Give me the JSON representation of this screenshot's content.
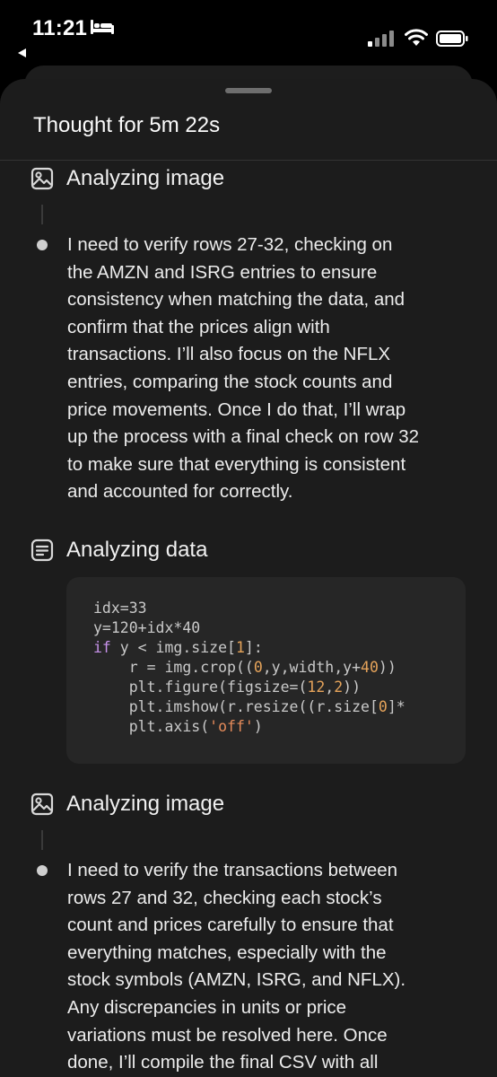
{
  "status_bar": {
    "time": "11:21",
    "icons": [
      "bed-icon",
      "back-arrow-icon",
      "cellular-signal-icon",
      "wifi-icon",
      "battery-icon"
    ]
  },
  "sheet": {
    "title": "Thought for 5m 22s"
  },
  "steps": [
    {
      "icon": "image-icon",
      "label": "Analyzing image",
      "lines": [
        "I need to verify rows 27-32, checking on",
        "the AMZN and ISRG entries to ensure",
        "consistency when matching the data, and",
        "confirm that the prices align with",
        "transactions. I’ll also focus on the NFLX",
        "entries, comparing the stock counts and",
        "price movements. Once I do that, I’ll wrap",
        "up the process with a final check on row 32",
        "to make sure that everything is consistent",
        "and accounted for correctly."
      ]
    },
    {
      "icon": "document-list-icon",
      "label": "Analyzing data",
      "code": [
        [
          [
            "plain",
            "idx=33"
          ]
        ],
        [
          [
            "plain",
            "y=120+idx*40"
          ]
        ],
        [
          [
            "kw",
            "if"
          ],
          [
            "plain",
            " y < img.size["
          ],
          [
            "num",
            "1"
          ],
          [
            "plain",
            "]:"
          ]
        ],
        [
          [
            "plain",
            "    r = img.crop(("
          ],
          [
            "num",
            "0"
          ],
          [
            "plain",
            ",y,width,y+"
          ],
          [
            "num",
            "40"
          ],
          [
            "plain",
            "))"
          ]
        ],
        [
          [
            "plain",
            "    plt.figure(figsize=("
          ],
          [
            "num",
            "12"
          ],
          [
            "plain",
            ","
          ],
          [
            "num",
            "2"
          ],
          [
            "plain",
            "))"
          ]
        ],
        [
          [
            "plain",
            "    plt.imshow(r.resize((r.size["
          ],
          [
            "num",
            "0"
          ],
          [
            "plain",
            "]*"
          ]
        ],
        [
          [
            "plain",
            "    plt.axis("
          ],
          [
            "str",
            "'off'"
          ],
          [
            "plain",
            ")"
          ]
        ]
      ]
    },
    {
      "icon": "image-icon",
      "label": "Analyzing image",
      "lines": [
        "I need to verify the transactions between",
        "rows 27 and 32, checking each stock’s",
        "count and prices carefully to ensure that",
        "everything matches, especially with the",
        "stock symbols (AMZN, ISRG, and NFLX).",
        "Any discrepancies in units or price",
        "variations must be resolved here. Once",
        "done, I’ll compile the final CSV with all"
      ]
    }
  ]
}
